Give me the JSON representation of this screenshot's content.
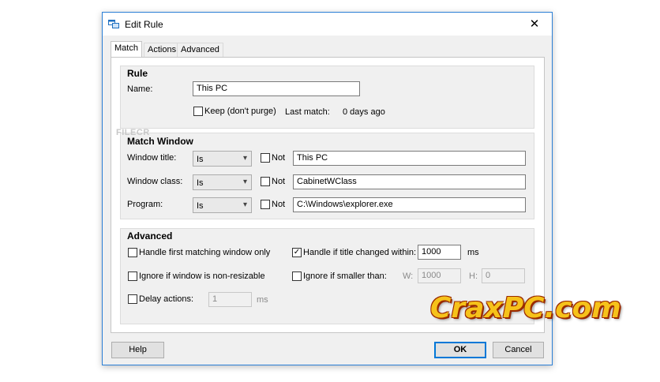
{
  "window": {
    "title": "Edit Rule",
    "close_glyph": "✕"
  },
  "tabs": [
    {
      "label": "Match"
    },
    {
      "label": "Actions"
    },
    {
      "label": "Advanced"
    }
  ],
  "rule": {
    "title": "Rule",
    "name_label": "Name:",
    "name_value": "This PC",
    "keep_label": "Keep (don't purge)",
    "keep_checked": false,
    "last_match_label": "Last match:",
    "last_match_value": "0 days ago"
  },
  "match_window": {
    "title": "Match Window",
    "rows": [
      {
        "label": "Window title:",
        "op": "Is",
        "not_label": "Not",
        "value": "This PC"
      },
      {
        "label": "Window class:",
        "op": "Is",
        "not_label": "Not",
        "value": "CabinetWClass"
      },
      {
        "label": "Program:",
        "op": "Is",
        "not_label": "Not",
        "value": "C:\\Windows\\explorer.exe"
      }
    ]
  },
  "advanced": {
    "title": "Advanced",
    "first_match_label": "Handle first matching window only",
    "title_changed_label": "Handle if title changed within:",
    "title_changed_checked": true,
    "title_changed_value": "1000",
    "title_changed_unit": "ms",
    "non_resizable_label": "Ignore if window is non-resizable",
    "smaller_label": "Ignore if smaller than:",
    "w_label": "W:",
    "w_value": "1000",
    "h_label": "H:",
    "h_value": "0",
    "delay_label": "Delay actions:",
    "delay_value": "1",
    "delay_unit": "ms"
  },
  "buttons": {
    "help": "Help",
    "ok": "OK",
    "cancel": "Cancel"
  },
  "watermarks": {
    "small": "FILECR",
    "large": "CraxPC.com"
  },
  "colors": {
    "accent": "#0078d7",
    "border": "#2b7fd6",
    "panel_bg": "#f0f0f0",
    "watermark": "#f6c21a"
  }
}
